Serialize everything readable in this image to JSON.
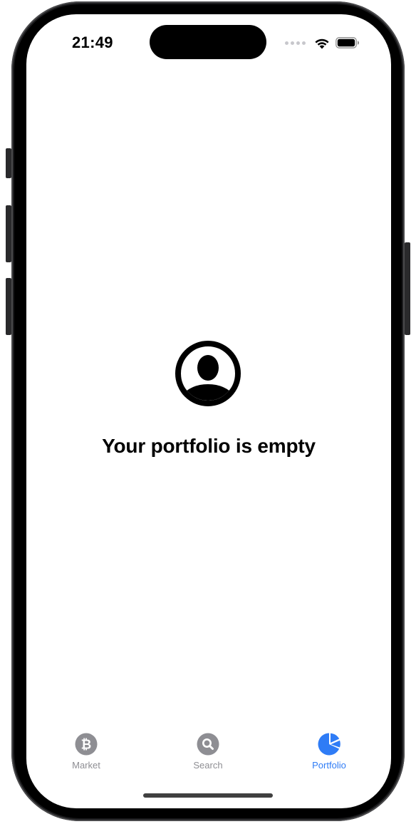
{
  "status_bar": {
    "time": "21:49"
  },
  "empty_state": {
    "icon": "person-circle-icon",
    "title": "Your portfolio is empty"
  },
  "tab_bar": {
    "tabs": [
      {
        "label": "Market",
        "icon": "bitcoin-circle-icon",
        "active": false
      },
      {
        "label": "Search",
        "icon": "magnifying-glass-circle-icon",
        "active": false
      },
      {
        "label": "Portfolio",
        "icon": "pie-chart-icon",
        "active": true
      }
    ]
  },
  "colors": {
    "accent": "#2f7cf6",
    "inactive": "#8e8e93",
    "text": "#000000",
    "background": "#ffffff"
  }
}
